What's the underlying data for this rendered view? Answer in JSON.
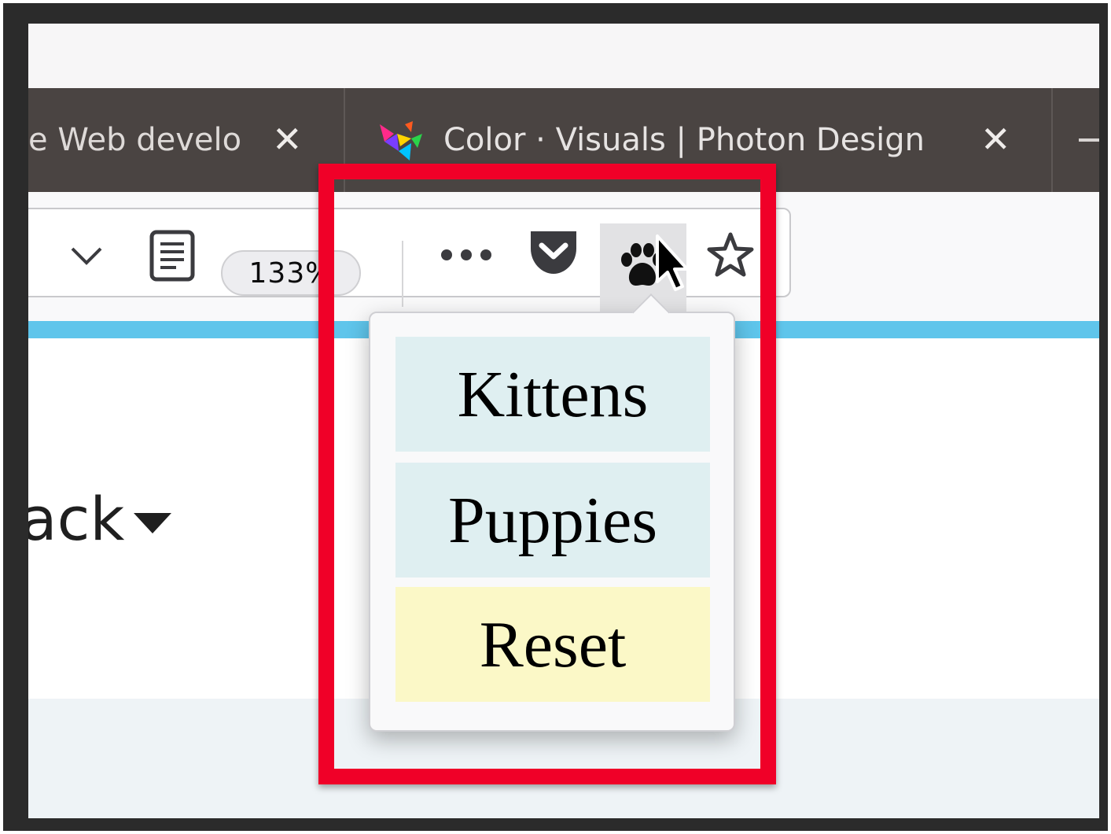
{
  "tabs": [
    {
      "title": "e Web develo",
      "close": "✕"
    },
    {
      "title": "Color · Visuals | Photon Design",
      "close": "✕"
    }
  ],
  "toolbar": {
    "zoom": "133%"
  },
  "page": {
    "partial_text": "ack"
  },
  "popup": {
    "items": [
      {
        "label": "Kittens",
        "bg": "#dfeff1"
      },
      {
        "label": "Puppies",
        "bg": "#dfeff1"
      },
      {
        "label": "Reset",
        "bg": "#fbf8c7"
      }
    ]
  },
  "colors": {
    "highlight": "#f00028",
    "progress": "#5fc5eb",
    "tabbar": "#4a4442"
  }
}
